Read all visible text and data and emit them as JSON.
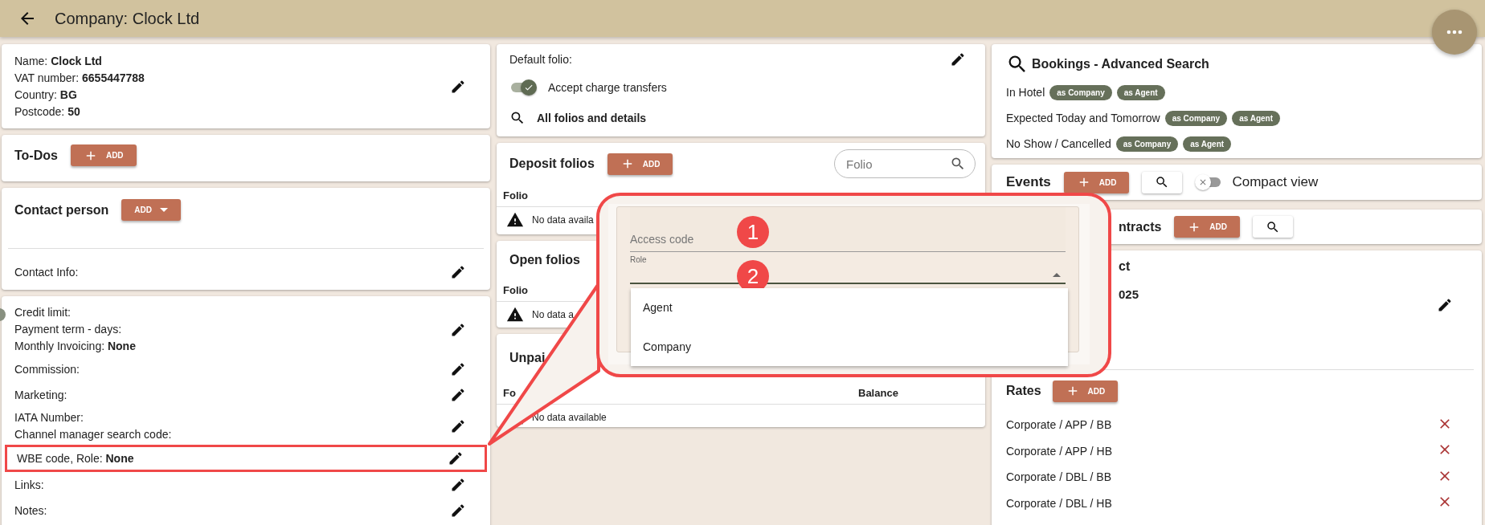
{
  "header": {
    "title": "Company: Clock Ltd"
  },
  "company_info": {
    "fields": [
      {
        "label": "Name:",
        "value": "Clock Ltd"
      },
      {
        "label": "VAT number:",
        "value": "6655447788"
      },
      {
        "label": "Country:",
        "value": "BG"
      },
      {
        "label": "Postcode:",
        "value": "50"
      }
    ]
  },
  "todos": {
    "title": "To-Dos",
    "button": {
      "label": "ADD",
      "kind": "plus"
    }
  },
  "contact_person": {
    "title": "Contact person",
    "button": {
      "label": "ADD",
      "kind": "dropdown"
    },
    "fields": [
      {
        "label": "Contact Info:"
      }
    ]
  },
  "details": {
    "groups": [
      {
        "lines": [
          {
            "label": "Credit limit:"
          },
          {
            "label": "Payment term - days:"
          },
          {
            "label": "Monthly Invoicing:",
            "value": "None"
          }
        ],
        "highlighted": false
      },
      {
        "lines": [
          {
            "label": "Commission:"
          }
        ],
        "highlighted": false
      },
      {
        "lines": [
          {
            "label": "Marketing:"
          }
        ],
        "highlighted": false
      },
      {
        "lines": [
          {
            "label": "IATA Number:"
          },
          {
            "label": "Channel manager search code:"
          }
        ],
        "highlighted": false
      },
      {
        "lines": [
          {
            "label": "WBE code, Role:",
            "value": "None"
          }
        ],
        "highlighted": true
      },
      {
        "lines": [
          {
            "label": "Links:"
          }
        ],
        "highlighted": false
      },
      {
        "lines": [
          {
            "label": "Notes:"
          }
        ],
        "highlighted": false
      }
    ]
  },
  "folio_settings": {
    "default_folio_label": "Default folio:",
    "toggle": {
      "label": "Accept charge transfers",
      "on": true
    },
    "link": "All folios and details"
  },
  "deposit_folios": {
    "title": "Deposit folios",
    "button": {
      "label": "ADD",
      "kind": "plus"
    },
    "search": {
      "placeholder": "Folio"
    },
    "columns": [
      "Folio"
    ],
    "empty_text": "No data availa"
  },
  "open_folios": {
    "title": "Open folios",
    "columns": [
      "Folio"
    ],
    "empty_text": "No data a"
  },
  "unpaid": {
    "title": "Unpai",
    "columns": [
      "Fo",
      "Balance"
    ],
    "empty_text": "No data available"
  },
  "bookings_search": {
    "title": "Bookings - Advanced Search",
    "rows": [
      {
        "label": "In Hotel",
        "chips": [
          "as Company",
          "as Agent"
        ]
      },
      {
        "label": "Expected Today and Tomorrow",
        "chips": [
          "as Company",
          "as Agent"
        ]
      },
      {
        "label": "No Show / Cancelled",
        "chips": [
          "as Company",
          "as Agent"
        ]
      }
    ]
  },
  "events": {
    "title": "Events",
    "button": {
      "label": "ADD",
      "kind": "plus"
    },
    "toggle": {
      "label": "Compact view",
      "on": false
    }
  },
  "contracts": {
    "title": "ntracts",
    "button": {
      "label": "ADD",
      "kind": "plus"
    }
  },
  "contract": {
    "title": "ct",
    "value": "025"
  },
  "rates": {
    "title": "Rates",
    "button": {
      "label": "ADD",
      "kind": "plus"
    },
    "items": [
      "Corporate / APP / BB",
      "Corporate / APP / HB",
      "Corporate / DBL / BB",
      "Corporate / DBL / HB"
    ]
  },
  "callout": {
    "fields": [
      {
        "kind": "text",
        "placeholder": "Access code",
        "badge": "1"
      },
      {
        "kind": "select",
        "label": "Role",
        "badge": "2",
        "expanded": true
      }
    ],
    "options": [
      "Agent",
      "Company"
    ]
  }
}
